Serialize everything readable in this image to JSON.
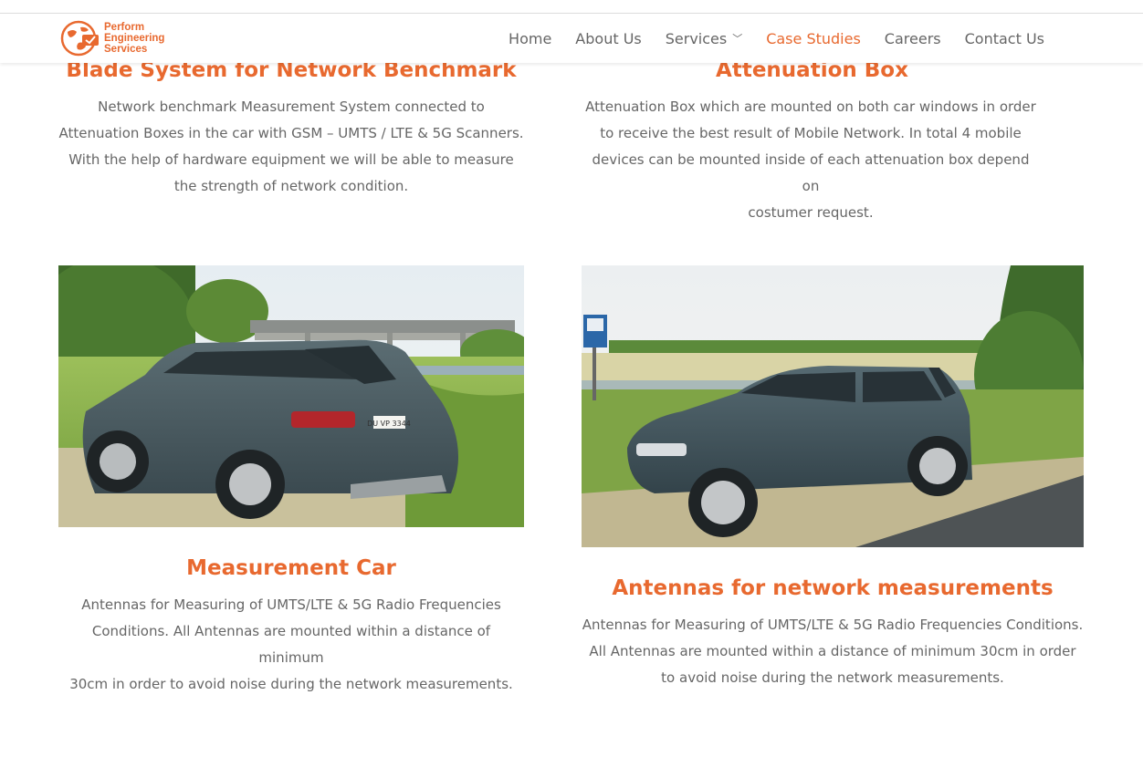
{
  "header": {
    "logo_lines": [
      "Perform",
      "Engineering",
      "Services"
    ],
    "nav": [
      {
        "label": "Home"
      },
      {
        "label": "About Us"
      },
      {
        "label": "Services",
        "has_dropdown": true
      },
      {
        "label": "Case Studies",
        "active": true
      },
      {
        "label": "Careers"
      },
      {
        "label": "Contact Us"
      }
    ]
  },
  "colors": {
    "accent": "#e8692f",
    "text": "#666666"
  },
  "sections": {
    "blade": {
      "title": "Blade System for Network Benchmark",
      "text": "Network benchmark Measurement System connected to\nAttenuation Boxes in the car with GSM – UMTS / LTE & 5G Scanners.\nWith the help of hardware equipment we will be    able to measure\nthe strength of network condition."
    },
    "attenuation": {
      "title": "Attenuation Box",
      "text": "Attenuation Box which are mounted on both car windows in order\nto receive the best result of Mobile Network. In total 4 mobile\ndevices can be mounted inside of each attenuation box depend on\ncostumer request."
    },
    "car": {
      "title": "Measurement Car",
      "text": "Antennas for Measuring of UMTS/LTE & 5G Radio Frequencies\nConditions. All Antennas are mounted within a distance of minimum\n30cm in order to avoid noise during the network measurements.",
      "plate": "DU VP 3344"
    },
    "antennas": {
      "title": "Antennas for network measurements",
      "text": "Antennas for Measuring of UMTS/LTE & 5G Radio Frequencies Conditions.\nAll Antennas are mounted within a distance of  minimum 30cm in order\nto avoid noise during the network measurements."
    }
  }
}
